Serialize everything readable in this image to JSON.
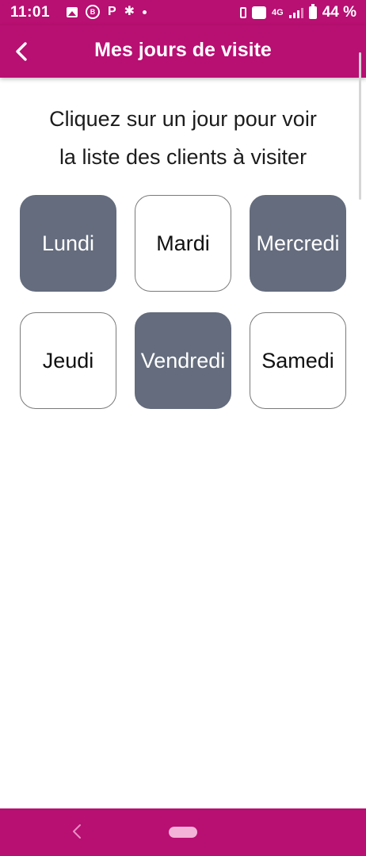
{
  "status_bar": {
    "time": "11:01",
    "network": "4G",
    "battery": "44 %",
    "icons": [
      "image-icon",
      "b-badge-icon",
      "p-icon",
      "gear-icon",
      "dot-icon",
      "vibrate-icon",
      "wifi-icon",
      "signal-icon",
      "battery-icon"
    ]
  },
  "header": {
    "title": "Mes jours de visite",
    "back_icon": "chevron-left-icon"
  },
  "instruction": {
    "line1": "Cliquez sur un jour pour voir",
    "line2": "la liste des clients à visiter"
  },
  "days": [
    {
      "label": "Lundi",
      "selected": true
    },
    {
      "label": "Mardi",
      "selected": false
    },
    {
      "label": "Mercredi",
      "selected": true
    },
    {
      "label": "Jeudi",
      "selected": false
    },
    {
      "label": "Vendredi",
      "selected": true
    },
    {
      "label": "Samedi",
      "selected": false
    }
  ],
  "colors": {
    "brand": "#b80f72",
    "selected_day": "#646c7d",
    "unselected_day": "#ffffff"
  },
  "nav_bar": {
    "icons": [
      "back-icon",
      "home-pill-icon"
    ]
  }
}
